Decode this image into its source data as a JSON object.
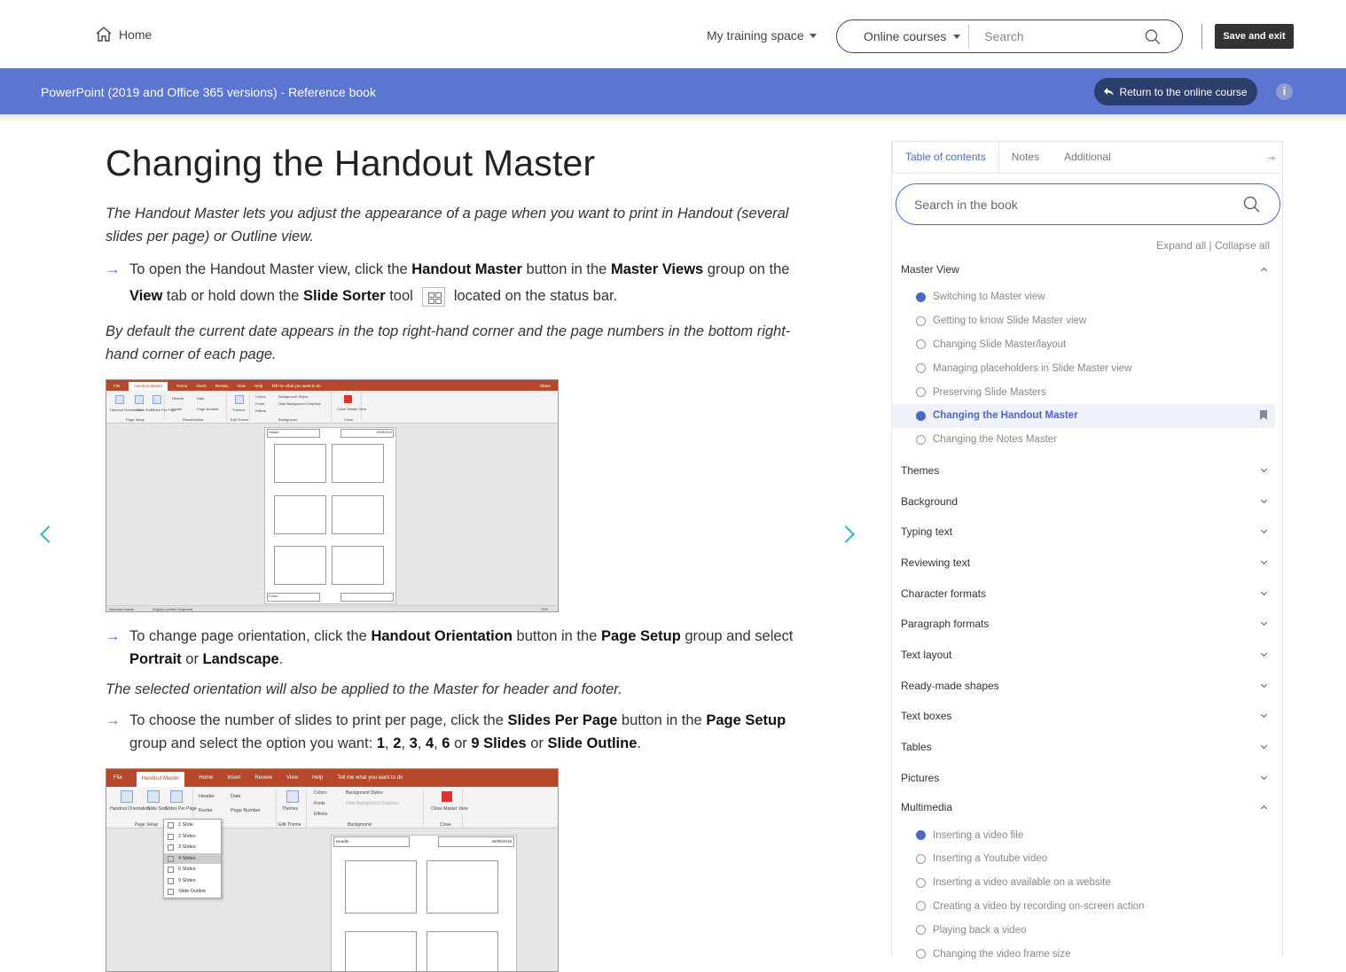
{
  "topnav": {
    "home_label": "Home",
    "training_label": "My training space",
    "course_select": "Online courses",
    "search_placeholder": "Search",
    "save_exit_label": "Save and exit"
  },
  "bluebar": {
    "book_title": "PowerPoint (2019 and Office 365 versions) - Reference book",
    "return_label": "Return to the online course",
    "info_label": "i"
  },
  "article": {
    "title": "Changing the Handout Master",
    "intro": "The Handout Master lets you adjust the appearance of a page when you want to print in Handout (several slides per page) or Outline view.",
    "bullet1": {
      "p1": "To open the Handout Master view, click the ",
      "b1": "Handout Master",
      "p2": " button in the ",
      "b2": "Master Views",
      "p3": " group on the ",
      "b3": "View",
      "p4": " tab or hold down the ",
      "b4": "Slide Sorter",
      "p5": " tool",
      "p6": "located on the status bar."
    },
    "note1": "By default the current date appears in the top right-hand corner and the page numbers in the bottom right-hand corner of each page.",
    "bullet2": {
      "p1": "To change page orientation, click the ",
      "b1": "Handout Orientation",
      "p2": " button in the ",
      "b2": "Page Setup",
      "p3": " group and select ",
      "b3": "Portrait",
      "p4": " or ",
      "b4": "Landscape",
      "p5": "."
    },
    "note2": "The selected orientation will also be applied to the Master for header and footer.",
    "bullet3": {
      "p1": "To choose the number of slides to print per page, click the ",
      "b1": "Slides Per Page",
      "p2": " button in the ",
      "b2": "Page Setup",
      "p3": " group and select the option you want: ",
      "b3": "1",
      "s1": ", ",
      "b4": "2",
      "s2": ", ",
      "b5": "3",
      "s3": ", ",
      "b6": "4",
      "s4": ", ",
      "b7": "6",
      "p4": " or ",
      "b8": "9 Slides",
      "p5": " or ",
      "b9": "Slide Outline",
      "p6": "."
    },
    "shot1": {
      "tabs": [
        "File",
        "Handout Master",
        "Home",
        "Insert",
        "Review",
        "View",
        "Help",
        "Tell me what you want to do"
      ],
      "share": "Share",
      "groups": [
        "Page Setup",
        "Placeholders",
        "Edit Theme",
        "Background",
        "Close"
      ],
      "buttons": [
        "Handout Orientation",
        "Slide Size",
        "Slides Per Page",
        "Header",
        "Date",
        "Footer",
        "Page Number",
        "Themes",
        "Colors",
        "Background Styles",
        "Fonts",
        "Hide Background Graphics",
        "Effects",
        "Close Master View"
      ],
      "header_ph": "Header",
      "date_ph": "25/05/2019",
      "footer_ph": "Footer",
      "status": [
        "Handout Master",
        "English (United Kingdom)",
        "70%"
      ]
    },
    "shot2": {
      "tabs": [
        "File",
        "Handout Master",
        "Home",
        "Insert",
        "Review",
        "View",
        "Help",
        "Tell me what you want to do"
      ],
      "groups": [
        "Page Setup",
        "Placeholders",
        "Edit Theme",
        "Background",
        "Close"
      ],
      "buttons": [
        "Handout Orientation",
        "Slide Size",
        "Slides Per Page",
        "Header",
        "Date",
        "Footer",
        "Page Number",
        "Themes",
        "Colors",
        "Background Styles",
        "Fonts",
        "Hide Background Graphics",
        "Effects",
        "Close Master View"
      ],
      "dropdown": [
        "1 Slide",
        "2 Slides",
        "3 Slides",
        "4 Slides",
        "6 Slides",
        "9 Slides",
        "Slide Outline"
      ],
      "header_ph": "Header",
      "date_ph": "25/05/2019"
    }
  },
  "sidebar": {
    "tabs": [
      "Table of contents",
      "Notes",
      "Additional"
    ],
    "search_placeholder": "Search in the book",
    "expand_all": "Expand all",
    "divider": " | ",
    "collapse_all": "Collapse all",
    "chapters": [
      {
        "title": "Master View",
        "open": true,
        "lessons": [
          {
            "title": "Switching to Master view",
            "done": true
          },
          {
            "title": "Getting to know Slide Master view",
            "done": false
          },
          {
            "title": "Changing Slide Master/layout",
            "done": false
          },
          {
            "title": "Managing placeholders in Slide Master view",
            "done": false
          },
          {
            "title": "Preserving Slide Masters",
            "done": false
          },
          {
            "title": "Changing the Handout Master",
            "done": true,
            "current": true
          },
          {
            "title": "Changing the Notes Master",
            "done": false
          }
        ]
      },
      {
        "title": "Themes"
      },
      {
        "title": "Background"
      },
      {
        "title": "Typing text"
      },
      {
        "title": "Reviewing text"
      },
      {
        "title": "Character formats"
      },
      {
        "title": "Paragraph formats"
      },
      {
        "title": "Text layout"
      },
      {
        "title": "Ready-made shapes"
      },
      {
        "title": "Text boxes"
      },
      {
        "title": "Tables"
      },
      {
        "title": "Pictures"
      },
      {
        "title": "Multimedia",
        "open": true,
        "lessons": [
          {
            "title": "Inserting a video file",
            "done": true
          },
          {
            "title": "Inserting a Youtube video",
            "done": false
          },
          {
            "title": "Inserting a video available on a website",
            "done": false
          },
          {
            "title": "Creating a video by recording on-screen action",
            "done": false
          },
          {
            "title": "Playing back a video",
            "done": false
          },
          {
            "title": "Changing the video frame size",
            "done": false
          }
        ]
      }
    ]
  },
  "colors": {
    "accent": "#4a69c4",
    "bluebar": "#5a75d2",
    "teal": "#2cb5b5",
    "ribbon": "#b7472a"
  }
}
